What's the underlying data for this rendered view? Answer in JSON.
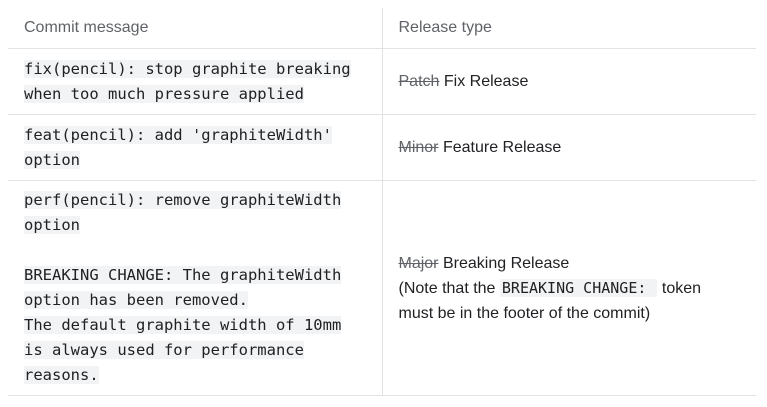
{
  "header": {
    "col1": "Commit message",
    "col2": "Release type"
  },
  "rows": [
    {
      "commit_lines": [
        "fix(pencil): stop graphite breaking",
        "when too much pressure applied"
      ],
      "strike": "Patch",
      "release": "Fix Release"
    },
    {
      "commit_lines": [
        "feat(pencil): add 'graphiteWidth'",
        "option"
      ],
      "strike": "Minor",
      "release": "Feature Release"
    },
    {
      "commit_block1": [
        "perf(pencil): remove graphiteWidth",
        "option"
      ],
      "commit_block2": [
        "BREAKING CHANGE: The graphiteWidth",
        "option has been removed.",
        "The default graphite width of 10mm",
        "is always used for performance",
        "reasons."
      ],
      "strike": "Major",
      "release": "Breaking Release",
      "note_prefix": "(Note that the",
      "note_code": "BREAKING CHANGE: ",
      "note_suffix": "token",
      "note_line2": "must be in the footer of the commit)"
    }
  ]
}
